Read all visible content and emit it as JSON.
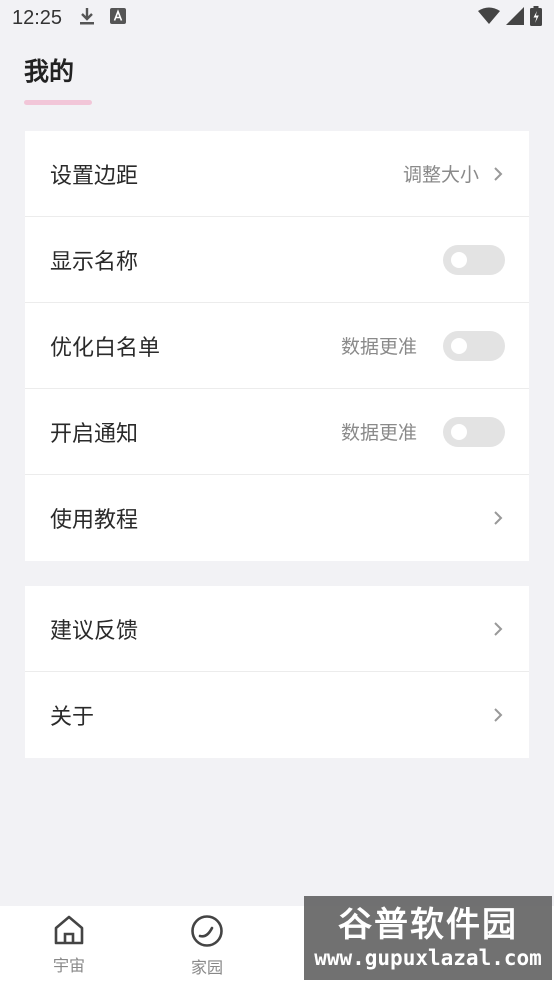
{
  "status_bar": {
    "time": "12:25",
    "icons": [
      "download-icon",
      "text-a-icon",
      "wifi-icon",
      "signal-icon",
      "battery-charging-icon"
    ]
  },
  "page": {
    "title": "我的",
    "accent_color": "#f2c6d8"
  },
  "settings_group_1": {
    "margin": {
      "label": "设置边距",
      "hint": "调整大小"
    },
    "show_name": {
      "label": "显示名称",
      "toggle_on": false
    },
    "whitelist": {
      "label": "优化白名单",
      "hint": "数据更准",
      "toggle_on": false
    },
    "notification": {
      "label": "开启通知",
      "hint": "数据更准",
      "toggle_on": false
    },
    "tutorial": {
      "label": "使用教程"
    }
  },
  "settings_group_2": {
    "feedback": {
      "label": "建议反馈"
    },
    "about": {
      "label": "关于"
    }
  },
  "bottom_nav": {
    "items": [
      {
        "label": "宇宙",
        "icon": "home-icon"
      },
      {
        "label": "家园",
        "icon": "circle-arc-icon"
      }
    ]
  },
  "watermark": {
    "title": "谷普软件园",
    "url": "www.gupuxlazal.com"
  }
}
